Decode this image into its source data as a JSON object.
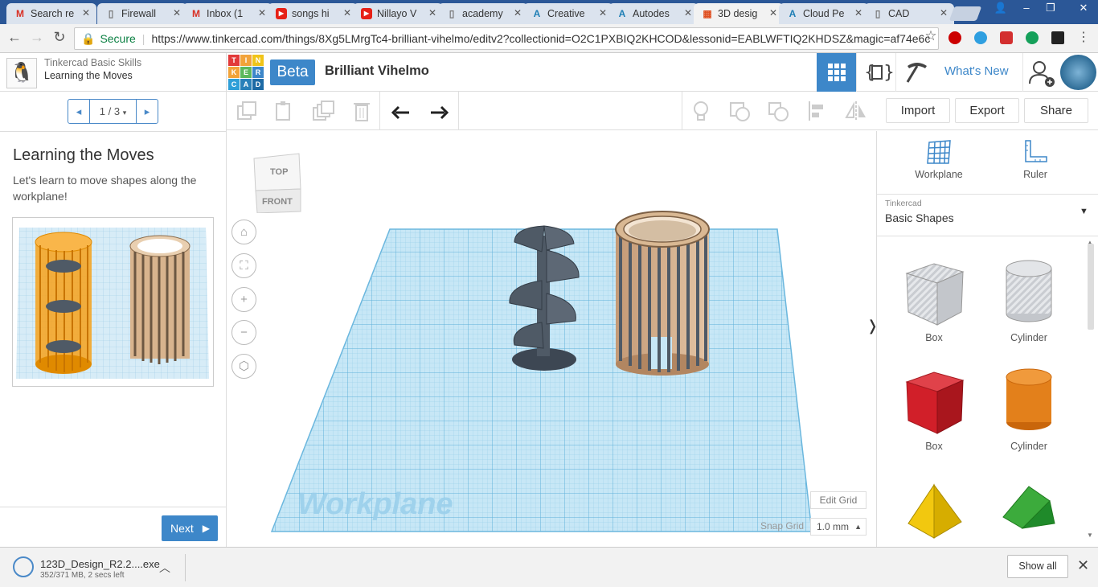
{
  "browser": {
    "tabs": [
      {
        "title": "Search re",
        "icon": "gmail-icon"
      },
      {
        "title": "Firewall",
        "icon": "doc-icon"
      },
      {
        "title": "Inbox (1",
        "icon": "gmail-icon"
      },
      {
        "title": "songs hi",
        "icon": "youtube-icon"
      },
      {
        "title": "Nillayo V",
        "icon": "youtube-icon"
      },
      {
        "title": "academy",
        "icon": "doc-icon"
      },
      {
        "title": "Creative",
        "icon": "autodesk-icon"
      },
      {
        "title": "Autodes",
        "icon": "autodesk-icon"
      },
      {
        "title": "3D desig",
        "icon": "tinkercad-icon"
      },
      {
        "title": "Cloud Pe",
        "icon": "autodesk-icon"
      },
      {
        "title": "CAD",
        "icon": "doc-icon"
      }
    ],
    "security_label": "Secure",
    "url": "https://www.tinkercad.com/things/8Xg5LMrgTc4-brilliant-vihelmo/editv2?collectionid=O2C1PXBIQ2KHCOD&lessonid=EABLWFTIQ2KHDSZ&magic=af74e6c"
  },
  "lesson_panel": {
    "course": "Tinkercad Basic Skills",
    "lesson": "Learning the Moves",
    "pager": "1 / 3",
    "title": "Learning the Moves",
    "description": "Let's learn to move shapes along the workplane!",
    "next_label": "Next"
  },
  "header": {
    "logo_letters": [
      "T",
      "I",
      "N",
      "K",
      "E",
      "R",
      "C",
      "A",
      "D"
    ],
    "beta_label": "Beta",
    "design_name": "Brilliant Vihelmo",
    "whats_new": "What's New"
  },
  "toolbar": {
    "import": "Import",
    "export": "Export",
    "share": "Share"
  },
  "viewport": {
    "viewcube_top": "TOP",
    "viewcube_front": "FRONT",
    "workplane_label": "Workplane",
    "edit_grid": "Edit Grid",
    "snap_grid_label": "Snap Grid",
    "snap_grid_value": "1.0 mm"
  },
  "right_panel": {
    "workplane_label": "Workplane",
    "ruler_label": "Ruler",
    "library_source": "Tinkercad",
    "library_name": "Basic Shapes",
    "shapes": [
      {
        "label": "Box"
      },
      {
        "label": "Cylinder"
      },
      {
        "label": "Box"
      },
      {
        "label": "Cylinder"
      }
    ]
  },
  "download": {
    "filename": "123D_Design_R2.2....exe",
    "status": "352/371 MB, 2 secs left",
    "show_all": "Show all"
  },
  "colors": {
    "accent": "#3d87c9",
    "tab_strip": "#2b5797",
    "grid": "#a9d8ef",
    "model": "#4f5a66"
  }
}
